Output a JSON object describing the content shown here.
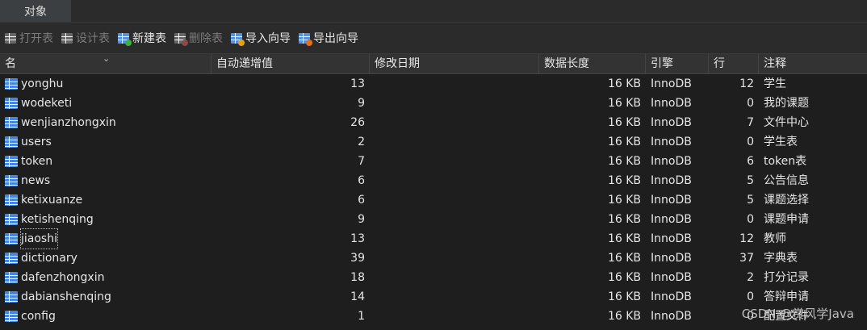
{
  "tabs": [
    {
      "label": "对象"
    }
  ],
  "toolbar": {
    "open_table": "打开表",
    "design_table": "设计表",
    "new_table": "新建表",
    "delete_table": "删除表",
    "import_wizard": "导入向导",
    "export_wizard": "导出向导"
  },
  "columns": {
    "name": "名",
    "auto_increment": "自动递增值",
    "modified": "修改日期",
    "data_length": "数据长度",
    "engine": "引擎",
    "rows": "行",
    "comment": "注释"
  },
  "tables": [
    {
      "name": "yonghu",
      "auto": "13",
      "size": "16 KB",
      "engine": "InnoDB",
      "rows": "12",
      "comment": "学生"
    },
    {
      "name": "wodeketi",
      "auto": "9",
      "size": "16 KB",
      "engine": "InnoDB",
      "rows": "0",
      "comment": "我的课题"
    },
    {
      "name": "wenjianzhongxin",
      "auto": "26",
      "size": "16 KB",
      "engine": "InnoDB",
      "rows": "7",
      "comment": "文件中心"
    },
    {
      "name": "users",
      "auto": "2",
      "size": "16 KB",
      "engine": "InnoDB",
      "rows": "0",
      "comment": "学生表"
    },
    {
      "name": "token",
      "auto": "7",
      "size": "16 KB",
      "engine": "InnoDB",
      "rows": "6",
      "comment": "token表"
    },
    {
      "name": "news",
      "auto": "6",
      "size": "16 KB",
      "engine": "InnoDB",
      "rows": "5",
      "comment": "公告信息"
    },
    {
      "name": "ketixuanze",
      "auto": "6",
      "size": "16 KB",
      "engine": "InnoDB",
      "rows": "5",
      "comment": "课题选择"
    },
    {
      "name": "ketishenqing",
      "auto": "9",
      "size": "16 KB",
      "engine": "InnoDB",
      "rows": "0",
      "comment": "课题申请"
    },
    {
      "name": "jiaoshi",
      "auto": "13",
      "size": "16 KB",
      "engine": "InnoDB",
      "rows": "12",
      "comment": "教师"
    },
    {
      "name": "dictionary",
      "auto": "39",
      "size": "16 KB",
      "engine": "InnoDB",
      "rows": "37",
      "comment": "字典表"
    },
    {
      "name": "dafenzhongxin",
      "auto": "18",
      "size": "16 KB",
      "engine": "InnoDB",
      "rows": "2",
      "comment": "打分记录"
    },
    {
      "name": "dabianshenqing",
      "auto": "14",
      "size": "16 KB",
      "engine": "InnoDB",
      "rows": "0",
      "comment": "答辩申请"
    },
    {
      "name": "config",
      "auto": "1",
      "size": "16 KB",
      "engine": "InnoDB",
      "rows": "0",
      "comment": "配置文件"
    }
  ],
  "selected_table": "jiaoshi",
  "watermark": "CSDN @赏风学Java"
}
